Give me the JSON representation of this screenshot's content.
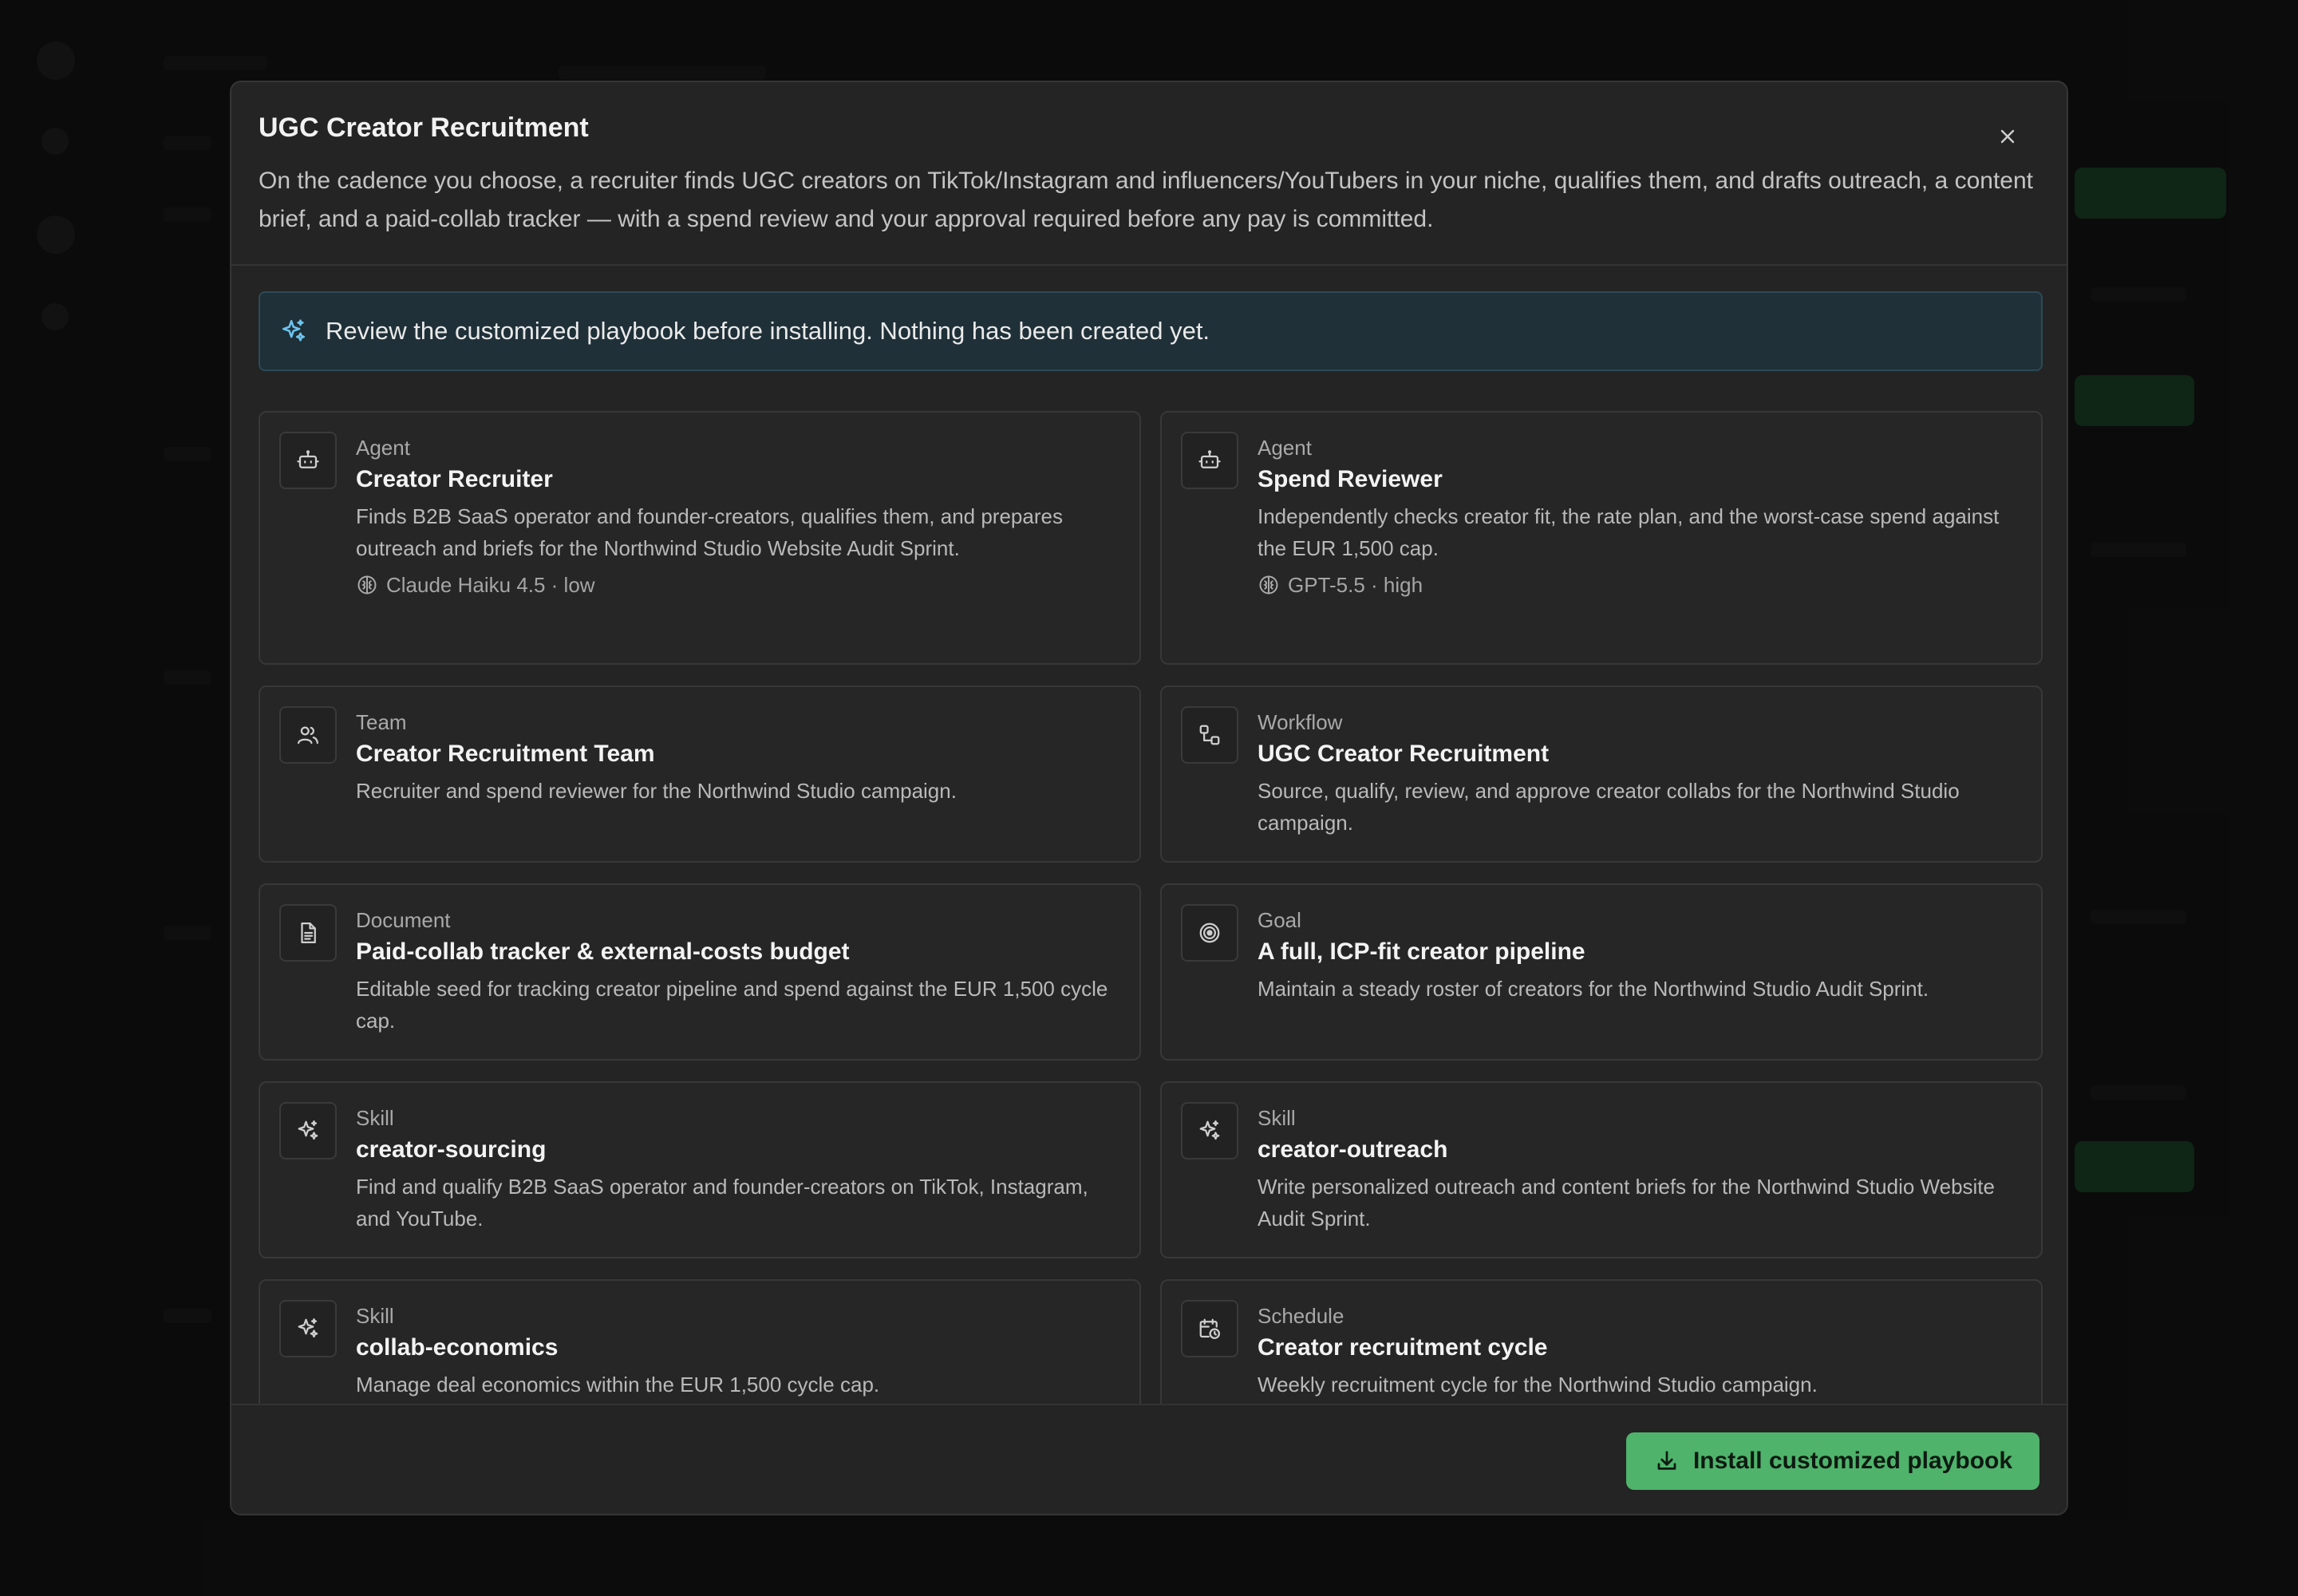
{
  "modal": {
    "title": "UGC Creator Recruitment",
    "description": "On the cadence you choose, a recruiter finds UGC creators on TikTok/Instagram and influencers/YouTubers in your niche, qualifies them, and drafts outreach, a content brief, and a paid-collab tracker — with a spend review and your approval required before any pay is committed.",
    "close_icon": "close-icon"
  },
  "notice": {
    "icon": "sparkles-icon",
    "text": "Review the customized playbook before installing. Nothing has been created yet."
  },
  "cards": [
    {
      "icon": "robot-icon",
      "type": "Agent",
      "title": "Creator Recruiter",
      "description": "Finds B2B SaaS operator and founder-creators, qualifies them, and prepares outreach and briefs for the Northwind Studio Website Audit Sprint.",
      "meta": "Claude Haiku 4.5 · low",
      "meta_icon": "brain-icon"
    },
    {
      "icon": "robot-icon",
      "type": "Agent",
      "title": "Spend Reviewer",
      "description": "Independently checks creator fit, the rate plan, and the worst-case spend against the EUR 1,500 cap.",
      "meta": "GPT-5.5 · high",
      "meta_icon": "brain-icon"
    },
    {
      "icon": "users-icon",
      "type": "Team",
      "title": "Creator Recruitment Team",
      "description": "Recruiter and spend reviewer for the Northwind Studio campaign."
    },
    {
      "icon": "workflow-icon",
      "type": "Workflow",
      "title": "UGC Creator Recruitment",
      "description": "Source, qualify, review, and approve creator collabs for the Northwind Studio campaign."
    },
    {
      "icon": "document-icon",
      "type": "Document",
      "title": "Paid-collab tracker & external-costs budget",
      "description": "Editable seed for tracking creator pipeline and spend against the EUR 1,500 cycle cap."
    },
    {
      "icon": "target-icon",
      "type": "Goal",
      "title": "A full, ICP-fit creator pipeline",
      "description": "Maintain a steady roster of creators for the Northwind Studio Audit Sprint."
    },
    {
      "icon": "sparkles-icon",
      "type": "Skill",
      "title": "creator-sourcing",
      "description": "Find and qualify B2B SaaS operator and founder-creators on TikTok, Instagram, and YouTube."
    },
    {
      "icon": "sparkles-icon",
      "type": "Skill",
      "title": "creator-outreach",
      "description": "Write personalized outreach and content briefs for the Northwind Studio Website Audit Sprint."
    },
    {
      "icon": "sparkles-icon",
      "type": "Skill",
      "title": "collab-economics",
      "description": "Manage deal economics within the EUR 1,500 cycle cap."
    },
    {
      "icon": "calendar-clock-icon",
      "type": "Schedule",
      "title": "Creator recruitment cycle",
      "description": "Weekly recruitment cycle for the Northwind Studio campaign."
    }
  ],
  "footer": {
    "install_label": "Install customized playbook",
    "install_icon": "download-icon"
  },
  "colors": {
    "accent_green": "#4fb36b",
    "notice_bg": "#1f3038",
    "notice_icon": "#6cc4ef"
  }
}
